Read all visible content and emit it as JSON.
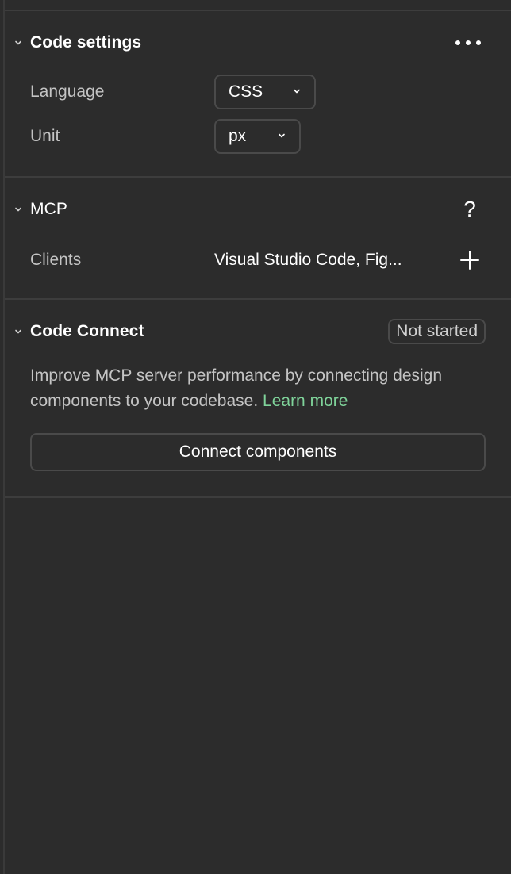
{
  "code_settings": {
    "title": "Code settings",
    "language_label": "Language",
    "language_value": "CSS",
    "unit_label": "Unit",
    "unit_value": "px"
  },
  "mcp": {
    "title": "MCP",
    "help_glyph": "?",
    "clients_label": "Clients",
    "clients_value": "Visual Studio Code, Fig..."
  },
  "code_connect": {
    "title": "Code Connect",
    "status_badge": "Not started",
    "description": "Improve MCP server performance by connecting design components to your codebase.",
    "learn_more": "Learn more",
    "connect_button": "Connect components"
  },
  "colors": {
    "background": "#2c2c2c",
    "border": "#4a4a4a",
    "link": "#7fd39a"
  }
}
